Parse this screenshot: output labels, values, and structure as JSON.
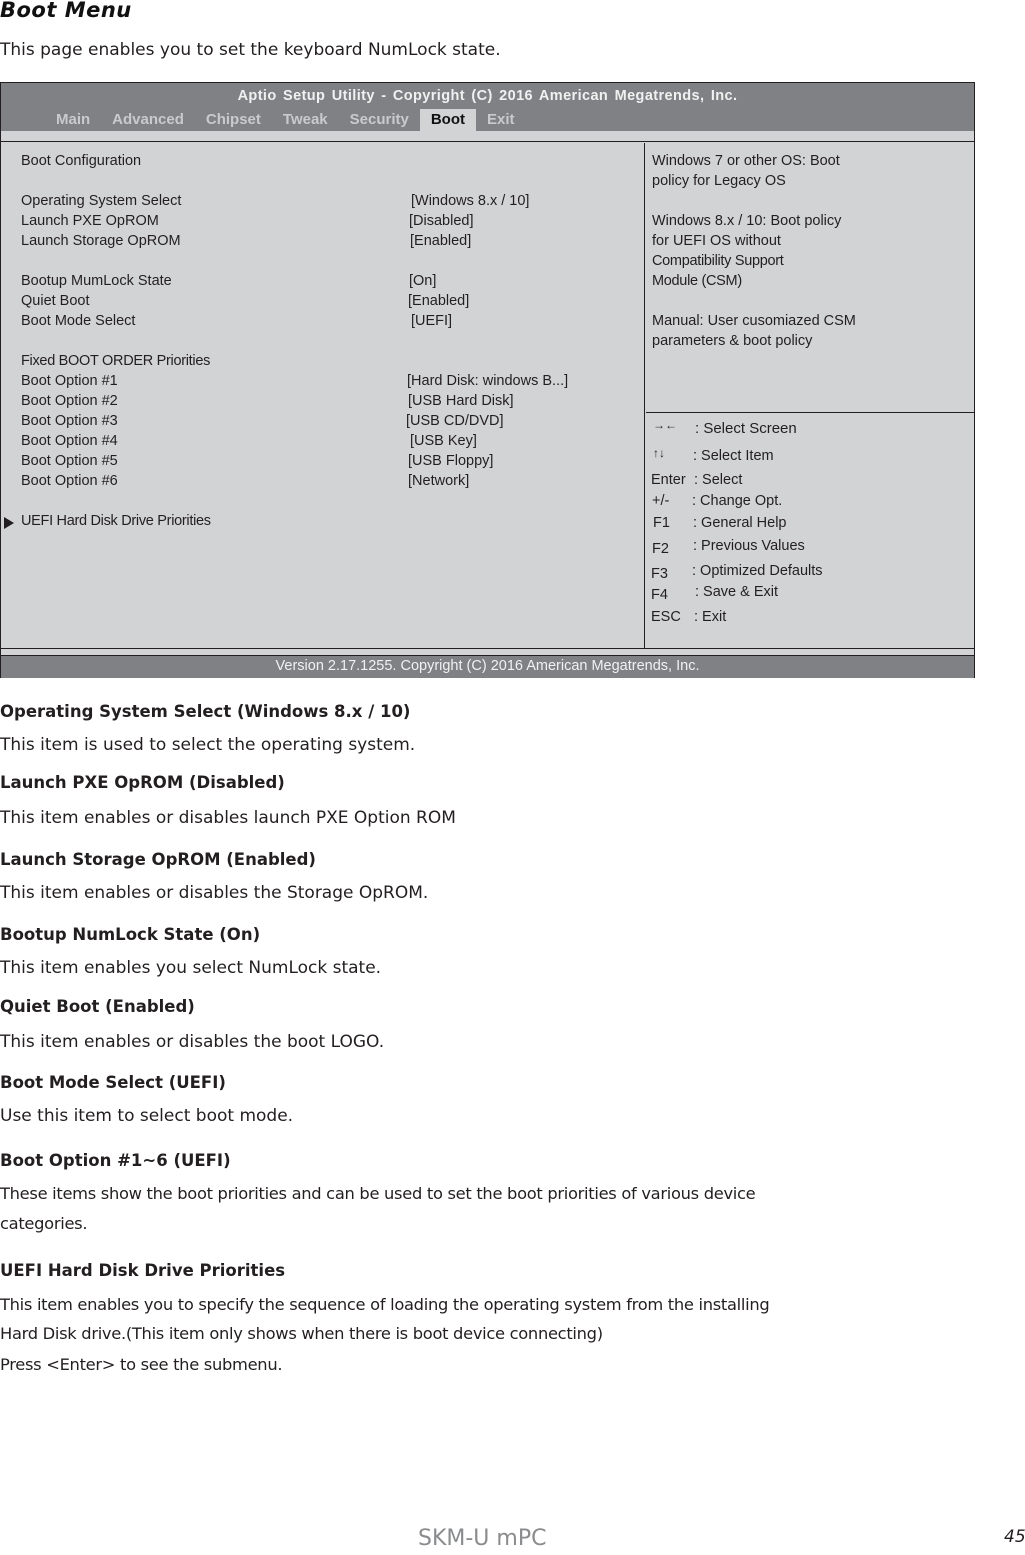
{
  "document": {
    "title": "Boot Menu",
    "intro": "This page enables you to set the keyboard NumLock state."
  },
  "bios": {
    "title": "Aptio Setup Utility - Copyright (C) 2016 American Megatrends, Inc.",
    "tabs": [
      {
        "label": "Main",
        "active": false
      },
      {
        "label": "Advanced",
        "active": false
      },
      {
        "label": "Chipset",
        "active": false
      },
      {
        "label": "Tweak",
        "active": false
      },
      {
        "label": "Security",
        "active": false
      },
      {
        "label": "Boot",
        "active": true
      },
      {
        "label": "Exit",
        "active": false
      }
    ],
    "section_boot_config": "Boot Configuration",
    "settings": [
      {
        "label": "Operating System Select",
        "value": "[Windows 8.x / 10]"
      },
      {
        "label": "Launch PXE OpROM",
        "value": "[Disabled]"
      },
      {
        "label": "Launch Storage OpROM",
        "value": "[Enabled]"
      },
      {
        "label": "Bootup MumLock State",
        "value": "[On]"
      },
      {
        "label": "Quiet Boot",
        "value": "[Enabled]"
      },
      {
        "label": "Boot Mode Select",
        "value": "[UEFI]"
      }
    ],
    "section_boot_order": "Fixed BOOT ORDER Priorities",
    "boot_options": [
      {
        "label": "Boot Option #1",
        "value": "[Hard Disk: windows B...]"
      },
      {
        "label": "Boot Option #2",
        "value": "[USB Hard Disk]"
      },
      {
        "label": "Boot Option #3",
        "value": "[USB CD/DVD]"
      },
      {
        "label": "Boot Option #4",
        "value": "[USB Key]"
      },
      {
        "label": "Boot Option #5",
        "value": "[USB Floppy]"
      },
      {
        "label": "Boot Option #6",
        "value": "[Network]"
      }
    ],
    "submenu": "UEFI Hard Disk Drive Priorities",
    "help_text": [
      "Windows 7 or other OS: Boot",
      "policy for Legacy OS",
      "",
      "Windows 8.x / 10: Boot policy",
      "for UEFI OS without",
      "Compatibility Support",
      "Module (CSM)",
      "",
      "Manual: User cusomiazed CSM",
      "parameters & boot policy"
    ],
    "keys": [
      {
        "key": "→←",
        "desc": ": Select Screen"
      },
      {
        "key": "↑↓",
        "desc": ": Select Item"
      },
      {
        "key": "Enter",
        "desc": ": Select"
      },
      {
        "key": "+/-",
        "desc": ": Change Opt."
      },
      {
        "key": "F1",
        "desc": ": General Help"
      },
      {
        "key": "F2",
        "desc": ": Previous Values"
      },
      {
        "key": "F3",
        "desc": ": Optimized Defaults"
      },
      {
        "key": "F4",
        "desc": ": Save & Exit"
      },
      {
        "key": "ESC",
        "desc": ": Exit"
      }
    ],
    "footer": "Version 2.17.1255. Copyright (C) 2016 American Megatrends, Inc.",
    "colors": {
      "header": "#808184",
      "panel": "#d2d3d5",
      "border": "#231f20"
    }
  },
  "sections": [
    {
      "heading": "Operating System Select (Windows 8.x / 10)",
      "body": [
        "This item is used to select the operating system."
      ]
    },
    {
      "heading": "Launch PXE OpROM (Disabled)",
      "body": [
        "This item enables or disables launch PXE Option ROM"
      ]
    },
    {
      "heading": "Launch Storage OpROM (Enabled)",
      "body": [
        "This item enables or disables the Storage OpROM."
      ]
    },
    {
      "heading": "Bootup NumLock State (On)",
      "body": [
        "This item enables you select NumLock state."
      ]
    },
    {
      "heading": "Quiet Boot (Enabled)",
      "body": [
        "This item enables or disables the boot LOGO."
      ]
    },
    {
      "heading": "Boot Mode Select (UEFI)",
      "body": [
        "Use this item to select boot mode."
      ]
    },
    {
      "heading": "Boot Option #1~6 (UEFI)",
      "body": [
        "These items show the boot priorities and can be used to set the boot priorities of various device",
        "categories."
      ]
    },
    {
      "heading": "UEFI Hard Disk Drive Priorities",
      "body": [
        "This item enables you to specify the sequence of loading the operating system from the installing",
        "Hard Disk drive.(This item only shows when there is boot device connecting)",
        "Press <Enter> to see the submenu."
      ]
    }
  ],
  "page_footer": {
    "model": "SKM-U mPC",
    "page_number": "45"
  }
}
